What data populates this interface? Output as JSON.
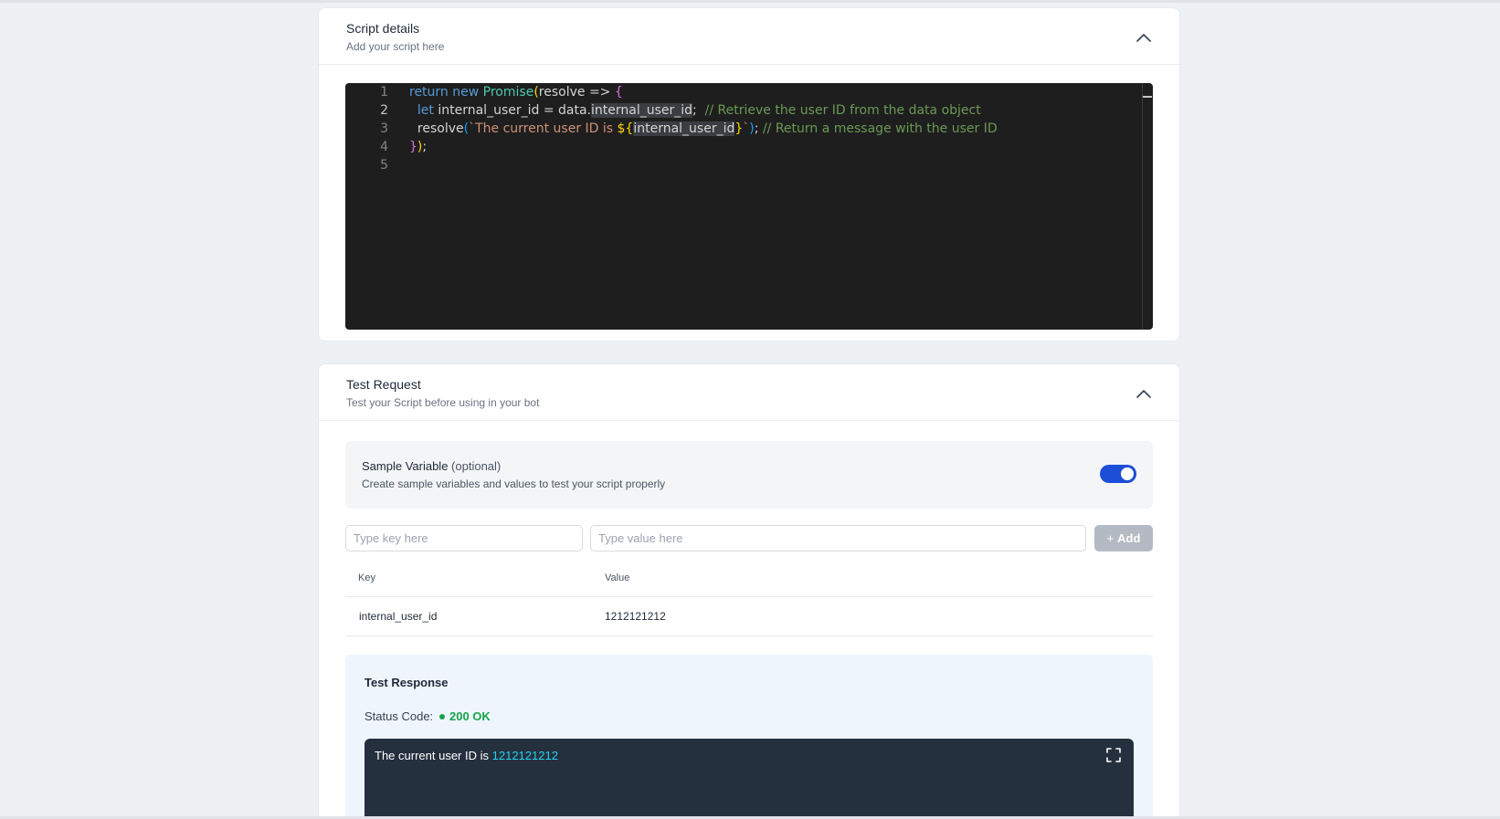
{
  "script_details": {
    "title": "Script details",
    "subtitle": "Add your script here",
    "line_numbers": [
      "1",
      "2",
      "3",
      "4",
      "5"
    ],
    "code": {
      "l1_kw": "return new",
      "l1_cls": "Promise",
      "l1_open": "(",
      "l1_rest": "resolve =>",
      "l1_brace": "{",
      "l2_kw": "let",
      "l2_a": " internal_user_id = data.",
      "l2_b": "internal_user_id",
      "l2_c": ";",
      "l2_cmt": "// Retrieve the user ID from the data object",
      "l3_fn": "resolve",
      "l3_open": "(",
      "l3_str1": "`The current user ID is ",
      "l3_tpl_open": "${",
      "l3_tpl_var": "internal_user_id",
      "l3_tpl_close": "}",
      "l3_str2": "`",
      "l3_close": ")",
      "l3_semi": ";",
      "l3_cmt": "// Return a message with the user ID",
      "l4_brace": "}",
      "l4_paren": ")",
      "l4_semi": ";"
    }
  },
  "test_request": {
    "title": "Test Request",
    "subtitle": "Test your Script before using in your bot",
    "sample": {
      "title": "Sample Variable",
      "optional": "(optional)",
      "subtitle": "Create sample variables and values to test your script properly",
      "enabled": true
    },
    "key_placeholder": "Type key here",
    "value_placeholder": "Type value here",
    "add_label": "Add",
    "add_icon": "plus-icon",
    "columns": {
      "key": "Key",
      "value": "Value"
    },
    "rows": [
      {
        "key": "internal_user_id",
        "value": "1212121212"
      }
    ],
    "response": {
      "title": "Test Response",
      "status_label": "Status Code:",
      "status_value": "200 OK",
      "status_color": "#16a34a",
      "output_text": "The current user ID is",
      "output_value": "1212121212"
    }
  }
}
